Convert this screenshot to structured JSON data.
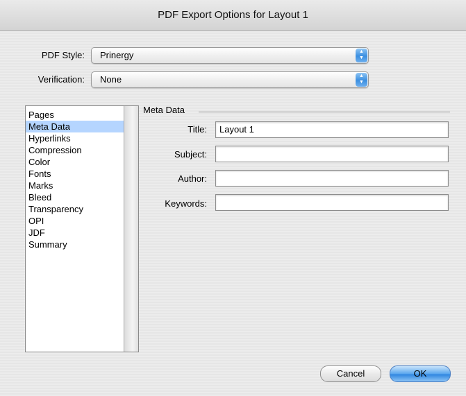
{
  "window": {
    "title": "PDF Export Options for Layout 1"
  },
  "settings": {
    "pdf_style_label": "PDF Style:",
    "pdf_style_value": "Prinergy",
    "verification_label": "Verification:",
    "verification_value": "None"
  },
  "sidebar": {
    "items": [
      {
        "label": "Pages"
      },
      {
        "label": "Meta Data"
      },
      {
        "label": "Hyperlinks"
      },
      {
        "label": "Compression"
      },
      {
        "label": "Color"
      },
      {
        "label": "Fonts"
      },
      {
        "label": "Marks"
      },
      {
        "label": "Bleed"
      },
      {
        "label": "Transparency"
      },
      {
        "label": "OPI"
      },
      {
        "label": "JDF"
      },
      {
        "label": "Summary"
      }
    ],
    "selected": "Meta Data"
  },
  "meta": {
    "section_title": "Meta Data",
    "title_label": "Title:",
    "title_value": "Layout 1",
    "subject_label": "Subject:",
    "subject_value": "",
    "author_label": "Author:",
    "author_value": "",
    "keywords_label": "Keywords:",
    "keywords_value": ""
  },
  "buttons": {
    "cancel": "Cancel",
    "ok": "OK"
  },
  "colors": {
    "accent": "#3b8fe0",
    "selection": "#b5d5ff"
  },
  "icons": {
    "popup_arrow": "chevron-up-down-icon"
  }
}
